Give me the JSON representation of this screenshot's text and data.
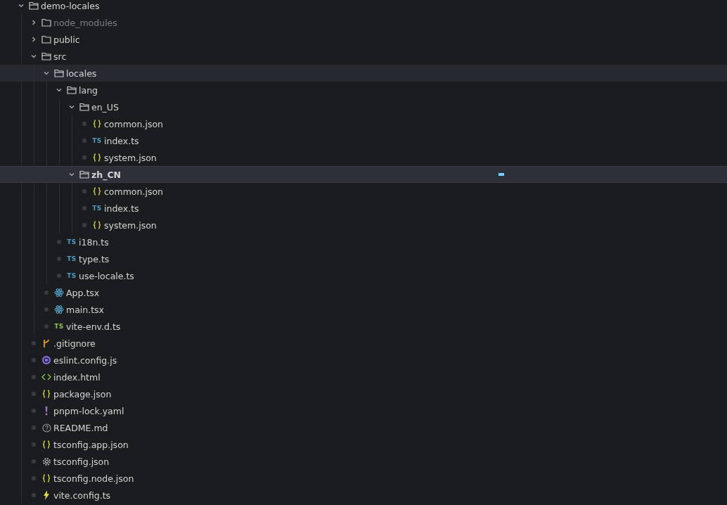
{
  "tree": [
    {
      "name": "demo-locales",
      "kind": "folder",
      "expanded": true,
      "children": [
        {
          "name": "node_modules",
          "kind": "folder",
          "expanded": false,
          "ignored": true
        },
        {
          "name": "public",
          "kind": "folder",
          "expanded": false
        },
        {
          "name": "src",
          "kind": "folder",
          "expanded": true,
          "children": [
            {
              "name": "locales",
              "kind": "folder",
              "expanded": true,
              "hovered": true,
              "children": [
                {
                  "name": "lang",
                  "kind": "folder",
                  "expanded": true,
                  "children": [
                    {
                      "name": "en_US",
                      "kind": "folder",
                      "expanded": true,
                      "selected": false,
                      "children": [
                        {
                          "name": "common.json",
                          "kind": "json"
                        },
                        {
                          "name": "index.ts",
                          "kind": "ts",
                          "badge": "TS"
                        },
                        {
                          "name": "system.json",
                          "kind": "json"
                        }
                      ]
                    },
                    {
                      "name": "zh_CN",
                      "kind": "folder",
                      "expanded": true,
                      "selected": true,
                      "children": [
                        {
                          "name": "common.json",
                          "kind": "json"
                        },
                        {
                          "name": "index.ts",
                          "kind": "ts",
                          "badge": "TS"
                        },
                        {
                          "name": "system.json",
                          "kind": "json"
                        }
                      ]
                    }
                  ]
                },
                {
                  "name": "i18n.ts",
                  "kind": "ts",
                  "badge": "TS"
                },
                {
                  "name": "type.ts",
                  "kind": "ts",
                  "badge": "TS"
                },
                {
                  "name": "use-locale.ts",
                  "kind": "ts",
                  "badge": "TS"
                }
              ]
            },
            {
              "name": "App.tsx",
              "kind": "react"
            },
            {
              "name": "main.tsx",
              "kind": "react"
            },
            {
              "name": "vite-env.d.ts",
              "kind": "tsd",
              "badge": "TS"
            }
          ]
        },
        {
          "name": ".gitignore",
          "kind": "git"
        },
        {
          "name": "eslint.config.js",
          "kind": "eslint"
        },
        {
          "name": "index.html",
          "kind": "html"
        },
        {
          "name": "package.json",
          "kind": "json"
        },
        {
          "name": "pnpm-lock.yaml",
          "kind": "yaml"
        },
        {
          "name": "README.md",
          "kind": "readme"
        },
        {
          "name": "tsconfig.app.json",
          "kind": "json"
        },
        {
          "name": "tsconfig.json",
          "kind": "config"
        },
        {
          "name": "tsconfig.node.json",
          "kind": "json"
        },
        {
          "name": "vite.config.ts",
          "kind": "vite"
        }
      ]
    }
  ]
}
